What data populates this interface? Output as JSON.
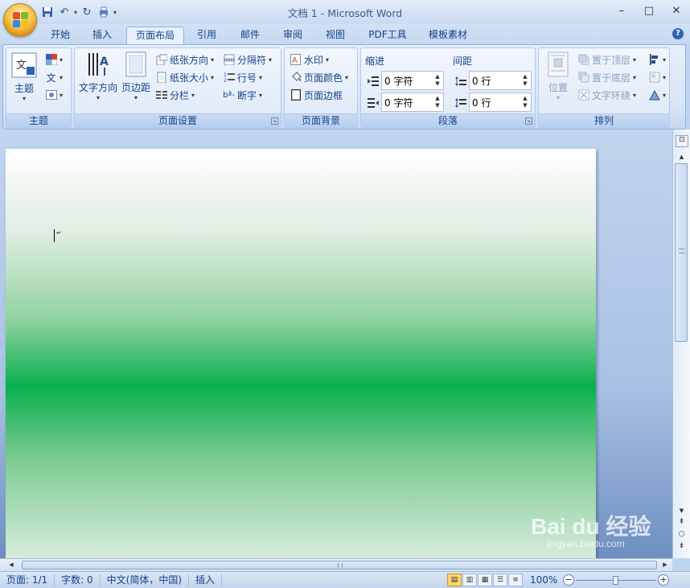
{
  "window": {
    "title": "文档 1 - Microsoft Word",
    "controls": [
      "–",
      "□",
      "✕"
    ]
  },
  "qat": {
    "save": "save-icon",
    "undo": "undo-icon",
    "redo": "redo-icon",
    "print": "print-icon",
    "customize": "▾"
  },
  "tabs": [
    {
      "label": "开始",
      "active": false
    },
    {
      "label": "插入",
      "active": false
    },
    {
      "label": "页面布局",
      "active": true
    },
    {
      "label": "引用",
      "active": false
    },
    {
      "label": "邮件",
      "active": false
    },
    {
      "label": "审阅",
      "active": false
    },
    {
      "label": "视图",
      "active": false
    },
    {
      "label": "PDF工具",
      "active": false
    },
    {
      "label": "模板素材",
      "active": false
    }
  ],
  "ribbon": {
    "theme": {
      "label": "主题",
      "theme_button": "主题"
    },
    "page_setup": {
      "label": "页面设置",
      "text_direction": "文字方向",
      "margins": "页边距",
      "orientation": "纸张方向",
      "size": "纸张大小",
      "columns": "分栏",
      "breaks": "分隔符",
      "line_numbers": "行号",
      "hyphenation": "断字"
    },
    "page_background": {
      "label": "页面背景",
      "watermark": "水印",
      "page_color": "页面颜色",
      "page_borders": "页面边框"
    },
    "paragraph": {
      "label": "段落",
      "indent_title": "缩进",
      "spacing_title": "间距",
      "indent_left": "0 字符",
      "indent_right": "0 字符",
      "spacing_before": "0 行",
      "spacing_after": "0 行"
    },
    "arrange": {
      "label": "排列",
      "position": "位置",
      "bring_to_front": "置于顶层",
      "send_to_back": "置于底层",
      "text_wrapping": "文字环绕"
    }
  },
  "statusbar": {
    "page": "页面: 1/1",
    "words": "字数: 0",
    "language": "中文(简体，中国)",
    "mode": "插入",
    "zoom": "100%"
  },
  "colors": {
    "page_gradient_mid": "#0aaf4f",
    "ribbon_text": "#15428b"
  },
  "watermark_text": {
    "logo": "Bai du 经验",
    "url": "jingyan.baidu.com"
  }
}
